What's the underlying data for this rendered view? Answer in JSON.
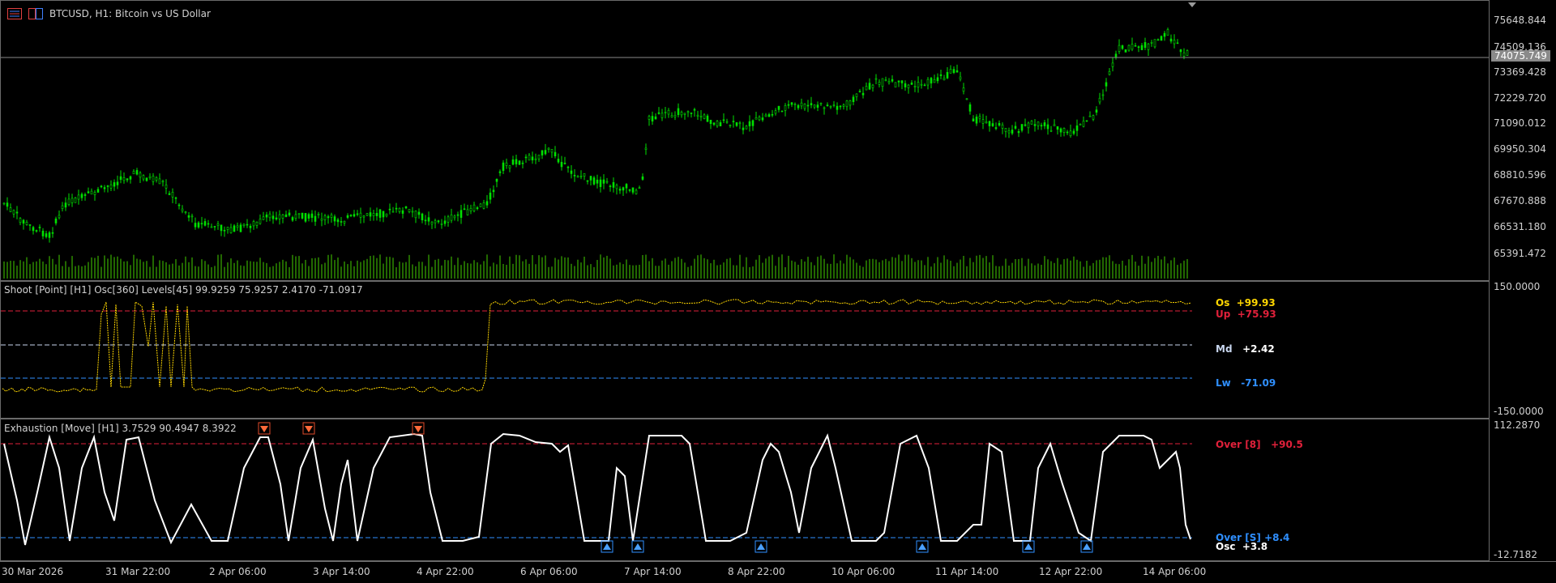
{
  "header": {
    "symbol_title": "BTCUSD, H1:  Bitcoin vs US Dollar"
  },
  "icons": [
    "bars-list-icon",
    "chart-compare-icon"
  ],
  "main_chart": {
    "price_labels": [
      "75648.844",
      "74509.136",
      "73369.428",
      "72229.720",
      "71090.012",
      "69950.304",
      "68810.596",
      "67670.888",
      "66531.180",
      "65391.472"
    ],
    "current_price": "74075.749",
    "colors": {
      "candle": "#00e000",
      "volume": "#2e8b00",
      "price_line": "#8a8a8a"
    }
  },
  "shoot_indicator": {
    "title": "Shoot [Point] [H1]  Osc[360]  Levels[45] 99.9259 75.9257 2.4170 -71.0917",
    "axis_top": "150.0000",
    "axis_bottom": "-150.0000",
    "levels": [
      {
        "name": "Os",
        "value": "+99.93",
        "color": "#ffd700"
      },
      {
        "name": "Up",
        "value": "+75.93",
        "color": "#e0203a"
      },
      {
        "name": "Md",
        "value": "+2.42",
        "color": "#c8d6ee"
      },
      {
        "name": "Lw",
        "value": "-71.09",
        "color": "#2f8fff"
      }
    ]
  },
  "exhaustion_indicator": {
    "title": "Exhaustion [Move] [H1] 3.7529 90.4947 8.3922",
    "axis_top": "112.2870",
    "axis_bottom": "-12.7182",
    "levels": [
      {
        "name": "Over [8]",
        "value": "+90.5",
        "color": "#e0203a"
      },
      {
        "name": "Over [S]",
        "value": "+8.4",
        "color": "#2f8fff"
      },
      {
        "name": "Osc",
        "value": "+3.8",
        "color": "#ffffff"
      }
    ]
  },
  "time_axis": [
    "30 Mar 2026",
    "31 Mar 22:00",
    "2 Apr 06:00",
    "3 Apr 14:00",
    "4 Apr 22:00",
    "6 Apr 06:00",
    "7 Apr 14:00",
    "8 Apr 22:00",
    "10 Apr 06:00",
    "11 Apr 14:00",
    "12 Apr 22:00",
    "14 Apr 06:00"
  ]
}
